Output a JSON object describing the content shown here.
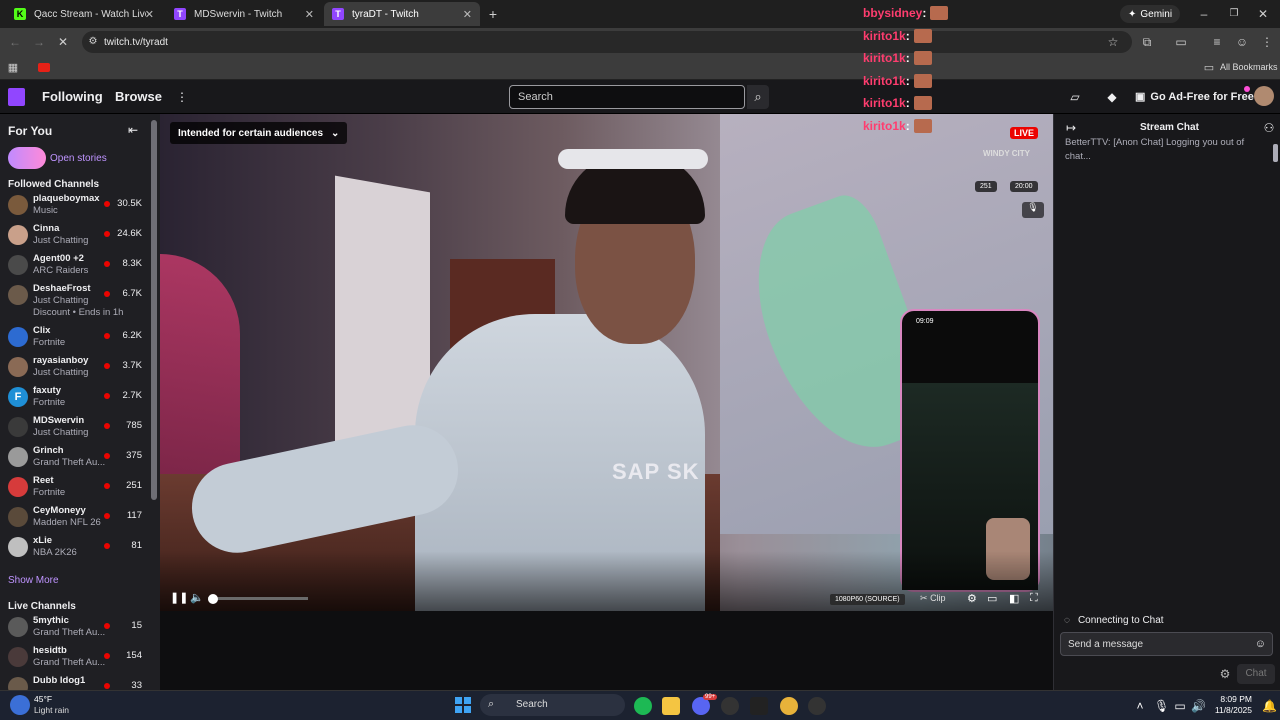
{
  "browser": {
    "tabs": [
      {
        "title": "Qacc Stream - Watch Live on K",
        "favicon": "K"
      },
      {
        "title": "MDSwervin - Twitch",
        "favicon": "T"
      },
      {
        "title": "tyraDT - Twitch",
        "favicon": "T"
      }
    ],
    "gemini_label": "Gemini",
    "url": "twitch.tv/tyradt",
    "all_bookmarks": "All Bookmarks"
  },
  "nav": {
    "following": "Following",
    "browse": "Browse",
    "search_placeholder": "Search",
    "ad_free": "Go Ad-Free for Free"
  },
  "sidebar": {
    "for_you": "For You",
    "open_stories": "Open stories",
    "followed_title": "Followed Channels",
    "followed": [
      {
        "name": "plaqueboymax",
        "game": "Music",
        "viewers": "30.5K",
        "color": "#7a5a3c"
      },
      {
        "name": "Cinna",
        "game": "Just Chatting",
        "viewers": "24.6K",
        "color": "#c9a08a"
      },
      {
        "name": "Agent00 +2",
        "game": "ARC Raiders",
        "viewers": "8.3K",
        "color": "#4a4a4a"
      },
      {
        "name": "DeshaeFrost",
        "game": "Just Chatting",
        "viewers": "6.7K",
        "color": "#6b5a4a",
        "extra": "Discount • Ends in 1h"
      },
      {
        "name": "Clix",
        "game": "Fortnite",
        "viewers": "6.2K",
        "color": "#2d6bd1"
      },
      {
        "name": "rayasianboy",
        "game": "Just Chatting",
        "viewers": "3.7K",
        "color": "#8a6a55"
      },
      {
        "name": "faxuty",
        "game": "Fortnite",
        "viewers": "2.7K",
        "color": "#1f8fd6",
        "letter": "F"
      },
      {
        "name": "MDSwervin",
        "game": "Just Chatting",
        "viewers": "785",
        "color": "#3a3a3a"
      },
      {
        "name": "Grinch",
        "game": "Grand Theft Au...",
        "viewers": "375",
        "color": "#9a9a9a"
      },
      {
        "name": "Reet",
        "game": "Fortnite",
        "viewers": "251",
        "color": "#d63b3b"
      },
      {
        "name": "CeyMoneyy",
        "game": "Madden NFL 26",
        "viewers": "117",
        "color": "#5a4a3a"
      },
      {
        "name": "xLie",
        "game": "NBA 2K26",
        "viewers": "81",
        "color": "#bfbfbf"
      }
    ],
    "show_more": "Show More",
    "live_title": "Live Channels",
    "live": [
      {
        "name": "5mythic",
        "game": "Grand Theft Au...",
        "viewers": "15",
        "color": "#5a5a5a"
      },
      {
        "name": "hesidtb",
        "game": "Grand Theft Au...",
        "viewers": "154",
        "color": "#4a3a3a"
      },
      {
        "name": "Dubb ldog1",
        "game": "",
        "viewers": "33",
        "color": "#6a5a4a"
      }
    ]
  },
  "video": {
    "audience_label": "Intended for certain audiences",
    "live_badge": "LIVE",
    "watermark": "WINDY CITY",
    "stat_a": "251",
    "stat_b": "20:00",
    "quality": "1080P60 (SOURCE)",
    "clip": "Clip",
    "necklace": "SAP SK",
    "phone_time": "09:09"
  },
  "overlay_chat": [
    {
      "user": "bbysidney"
    },
    {
      "user": "kirito1k"
    },
    {
      "user": "kirito1k"
    },
    {
      "user": "kirito1k"
    },
    {
      "user": "kirito1k"
    },
    {
      "user": "kirito1k"
    }
  ],
  "chat": {
    "title": "Stream Chat",
    "message": "BetterTTV: [Anon Chat] Logging you out of chat...",
    "connecting": "Connecting to Chat",
    "input_placeholder": "Send a message",
    "chat_button": "Chat"
  },
  "taskbar": {
    "weather_temp": "45°F",
    "weather_desc": "Light rain",
    "search": "Search",
    "time": "8:09 PM",
    "date": "11/8/2025",
    "badge": "99+"
  },
  "colors": {
    "twitch_purple": "#9146ff",
    "live_red": "#eb0400",
    "overlay_name": "#ff3d6f"
  }
}
